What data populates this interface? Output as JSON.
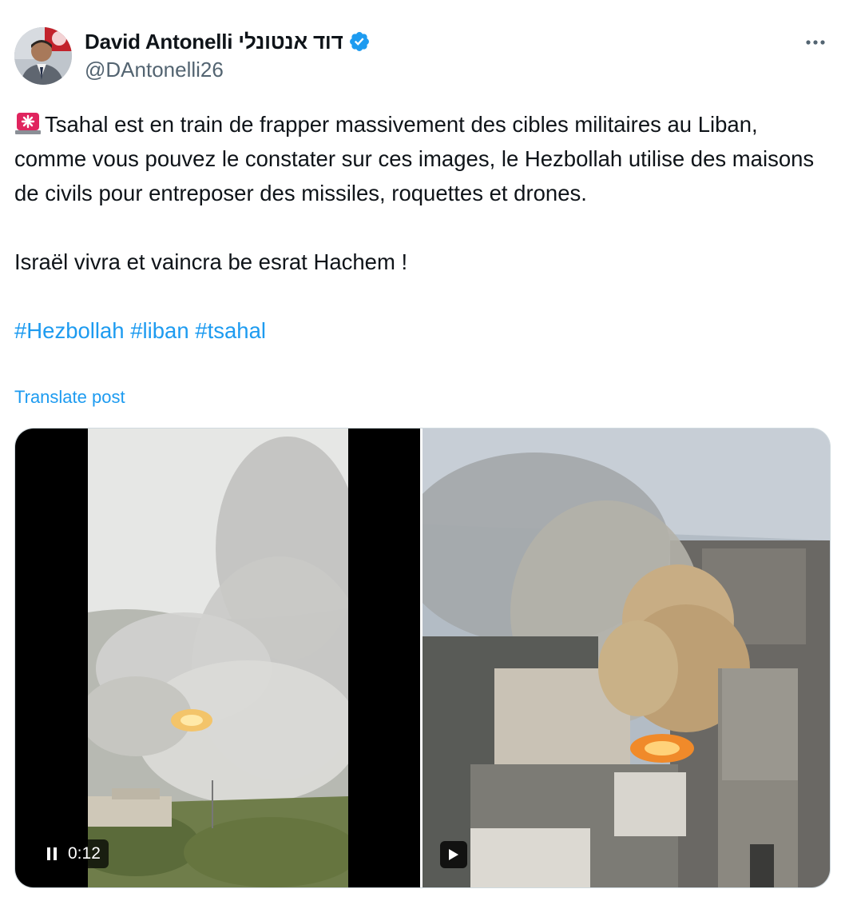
{
  "author": {
    "display_name": "David Antonelli דוד אנטונלי",
    "handle": "@DAntonelli26",
    "verified_color": "#1d9bf0"
  },
  "tweet": {
    "paragraph1": "Tsahal est en train de frapper massivement des cibles militaires au Liban, comme vous pouvez le constater sur ces images, le Hezbollah utilise des maisons de civils pour entreposer des missiles, roquettes et drones.",
    "paragraph2": "Israël vivra et vaincra be esrat Hachem !",
    "hashtags": [
      "#Hezbollah",
      "#liban",
      "#tsahal"
    ],
    "emoji": "rotating-light-icon"
  },
  "translate_label": "Translate post",
  "media": {
    "video1": {
      "time": "0:12",
      "state": "playing"
    },
    "video2": {
      "state": "paused"
    }
  },
  "colors": {
    "link": "#1d9bf0",
    "text": "#0f1419",
    "secondary": "#536471"
  }
}
